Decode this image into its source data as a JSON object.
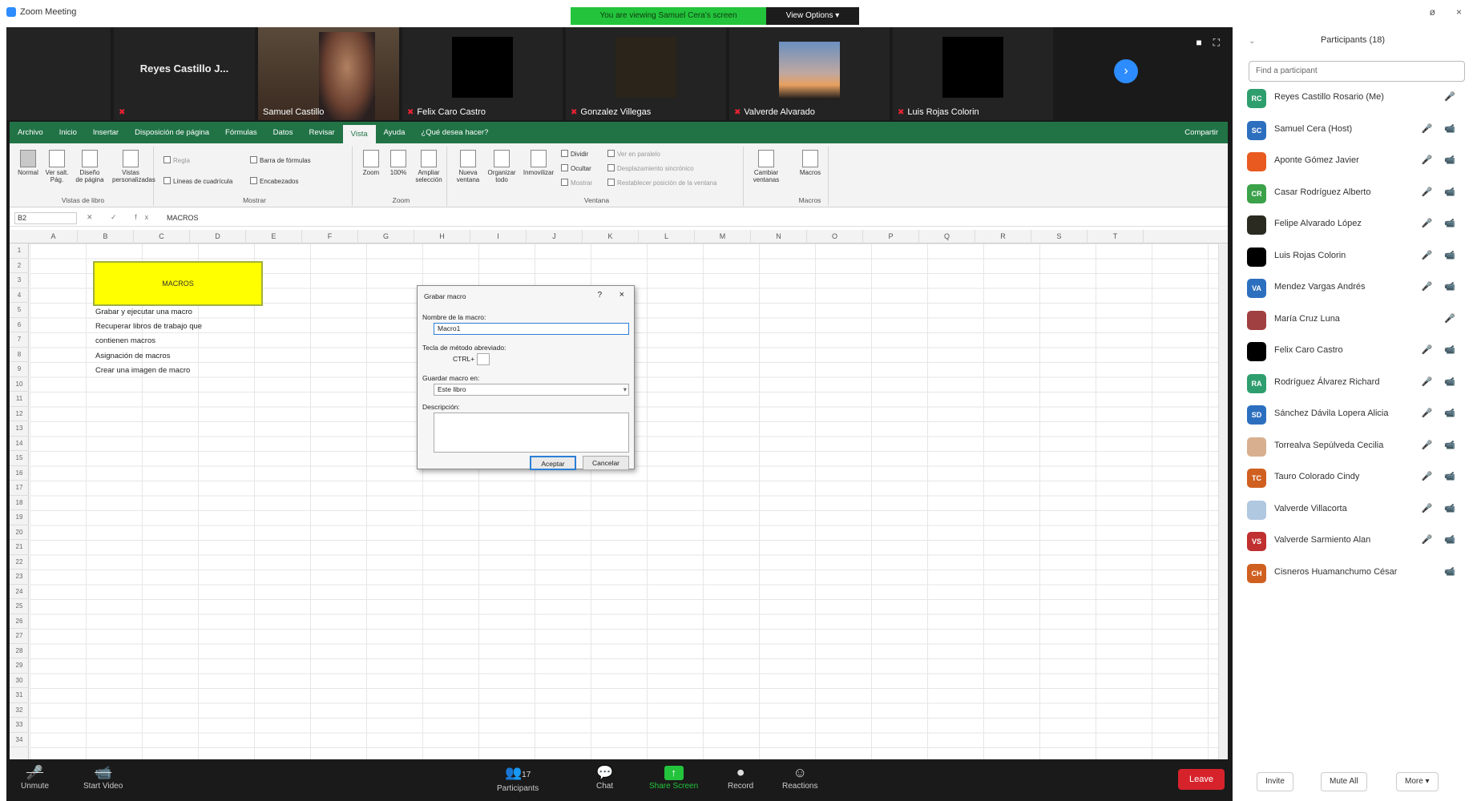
{
  "window": {
    "title": "Zoom Meeting",
    "share_banner": "You are viewing Samuel Cera's screen",
    "view_options": "View Options ▾",
    "min": "ø",
    "close": "×"
  },
  "filmstrip": {
    "tiles": [
      {
        "name": "",
        "big_name": "",
        "muted": false
      },
      {
        "name": "",
        "big_name": "Reyes Castillo J...",
        "muted": true
      },
      {
        "name": "Samuel Castillo",
        "big_name": "",
        "muted": false
      },
      {
        "name": "Felix Caro Castro",
        "big_name": "",
        "muted": true
      },
      {
        "name": "Gonzalez Villegas",
        "big_name": "",
        "muted": true
      },
      {
        "name": "Valverde Alvarado",
        "big_name": "",
        "muted": true
      },
      {
        "name": "Luis Rojas Colorin",
        "big_name": "",
        "muted": true
      }
    ],
    "next_icon": "chevron-right-icon"
  },
  "excel": {
    "tabs": [
      "Archivo",
      "Inicio",
      "Insertar",
      "Disposición de página",
      "Fórmulas",
      "Datos",
      "Revisar",
      "Vista",
      "Ayuda",
      "¿Qué desea hacer?"
    ],
    "active_tab": "Vista",
    "share_label": "Compartir",
    "ribbon": {
      "views": {
        "group": "Vistas de libro",
        "buttons": [
          "Normal",
          "Ver salt. Pág.",
          "Diseño de página",
          "Vistas personalizadas"
        ]
      },
      "show": {
        "group": "Mostrar",
        "items": [
          "Regla",
          "Barra de fórmulas",
          "Líneas de cuadrícula",
          "Encabezados"
        ]
      },
      "zoom": {
        "group": "Zoom",
        "buttons": [
          "Zoom",
          "100%",
          "Ampliar selección"
        ]
      },
      "window": {
        "group": "Ventana",
        "buttons": [
          "Nueva ventana",
          "Organizar todo",
          "Inmovilizar"
        ],
        "small": [
          "Dividir",
          "Ocultar",
          "Mostrar"
        ],
        "dim": [
          "Ver en paralelo",
          "Desplazamiento sincrónico",
          "Restablecer posición de la ventana"
        ],
        "switch": "Cambiar ventanas"
      },
      "macros": {
        "group": "Macros",
        "button": "Macros"
      }
    },
    "name_box": "B2",
    "formula": "MACROS",
    "columns": [
      "A",
      "B",
      "C",
      "D",
      "E",
      "F",
      "G",
      "H",
      "I",
      "J",
      "K",
      "L",
      "M",
      "N",
      "O",
      "P",
      "Q",
      "R",
      "S",
      "T"
    ],
    "rows": [
      "1",
      "2",
      "3",
      "4",
      "5",
      "6",
      "7",
      "8",
      "9",
      "10",
      "11",
      "12",
      "13",
      "14",
      "15",
      "16",
      "17",
      "18",
      "19",
      "20",
      "21",
      "22",
      "23",
      "24",
      "25",
      "26",
      "27",
      "28",
      "29",
      "30",
      "31",
      "32",
      "33",
      "34"
    ],
    "macros_cell": "MACROS",
    "list": [
      "Grabar y ejecutar una macro",
      "Recuperar libros de trabajo que",
      "contienen macros",
      "Asignación de macros",
      "Crear una imagen de macro"
    ],
    "dialog": {
      "title": "Grabar macro",
      "help": "?",
      "close": "×",
      "name_label": "Nombre de la macro:",
      "name_value": "Macro1",
      "shortcut_label": "Tecla de método abreviado:",
      "shortcut_prefix": "CTRL+",
      "store_label": "Guardar macro en:",
      "store_value": "Este libro",
      "desc_label": "Descripción:",
      "ok": "Aceptar",
      "cancel": "Cancelar"
    }
  },
  "toolbar": {
    "mute": "Unmute",
    "video": "Start Video",
    "participants": "Participants",
    "participants_count": "17",
    "chat": "Chat",
    "share": "Share Screen",
    "record": "Record",
    "reactions": "Reactions",
    "leave": "Leave"
  },
  "panel": {
    "title": "Participants (18)",
    "search_placeholder": "Find a participant",
    "participants": [
      {
        "initials": "RC",
        "color": "#2f9e6e",
        "name": "Reyes Castillo Rosario (Me)",
        "icons": "🎤"
      },
      {
        "initials": "SC",
        "color": "#2d6fbf",
        "name": "Samuel Cera (Host)",
        "icons": "🎤 📹"
      },
      {
        "initials": "",
        "color": "#e85a20",
        "name": "Aponte Gómez Javier",
        "icons": "🎤 📹"
      },
      {
        "initials": "CR",
        "color": "#3ba24a",
        "name": "Casar Rodríguez Alberto",
        "icons": "🎤 📹"
      },
      {
        "initials": "",
        "color": "#2a2a20",
        "name": "Felipe Alvarado López",
        "icons": "🎤 📹"
      },
      {
        "initials": "",
        "color": "#000000",
        "name": "Luis Rojas Colorin",
        "icons": "🎤 📹"
      },
      {
        "initials": "VA",
        "color": "#2d6fbf",
        "name": "Mendez Vargas Andrés",
        "icons": "🎤 📹"
      },
      {
        "initials": "",
        "color": "#a04040",
        "name": "María Cruz Luna",
        "icons": "🎤"
      },
      {
        "initials": "",
        "color": "#000000",
        "name": "Felix Caro Castro",
        "icons": "🎤 📹"
      },
      {
        "initials": "RA",
        "color": "#2f9e6e",
        "name": "Rodríguez Álvarez Richard",
        "icons": "🎤 📹"
      },
      {
        "initials": "SD",
        "color": "#2d6fbf",
        "name": "Sánchez Dávila Lopera Alicia",
        "icons": "🎤 📹"
      },
      {
        "initials": "",
        "color": "#d8b090",
        "name": "Torrealva Sepúlveda Cecilia",
        "icons": "🎤 📹"
      },
      {
        "initials": "TC",
        "color": "#d06020",
        "name": "Tauro Colorado Cindy",
        "icons": "🎤 📹"
      },
      {
        "initials": "",
        "color": "#b0c8e0",
        "name": "Valverde Villacorta",
        "icons": "🎤 📹"
      },
      {
        "initials": "VS",
        "color": "#c03030",
        "name": "Valverde Sarmiento Alan",
        "icons": "🎤 📹"
      },
      {
        "initials": "CH",
        "color": "#d06020",
        "name": "Cisneros Huamanchumo César",
        "icons": "📹"
      }
    ],
    "footer": {
      "invite": "Invite",
      "mute_all": "Mute All",
      "more": "More ▾"
    }
  }
}
